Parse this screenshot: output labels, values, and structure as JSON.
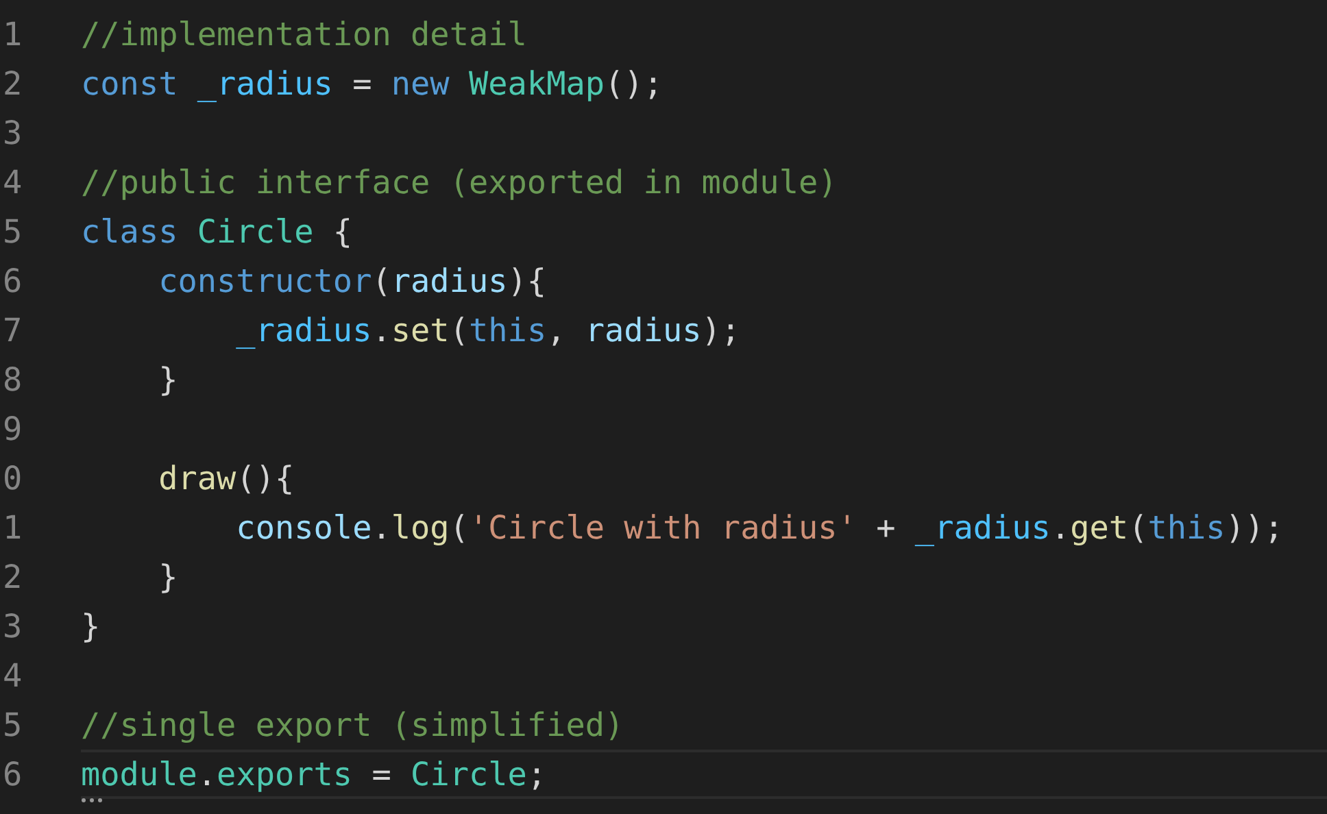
{
  "editor": {
    "lines": [
      {
        "number": "1",
        "current": false,
        "tokens": [
          {
            "kind": "comment",
            "text": "//implementation detail"
          }
        ]
      },
      {
        "number": "2",
        "current": false,
        "tokens": [
          {
            "kind": "keyword",
            "text": "const "
          },
          {
            "kind": "constant",
            "text": "_radius"
          },
          {
            "kind": "plain",
            "text": " = "
          },
          {
            "kind": "keyword",
            "text": "new "
          },
          {
            "kind": "type",
            "text": "WeakMap"
          },
          {
            "kind": "plain",
            "text": "();"
          }
        ]
      },
      {
        "number": "3",
        "current": false
      },
      {
        "number": "4",
        "current": false,
        "tokens": [
          {
            "kind": "comment",
            "text": "//public interface (exported in module)"
          }
        ]
      },
      {
        "number": "5",
        "current": false,
        "tokens": [
          {
            "kind": "keyword",
            "text": "class "
          },
          {
            "kind": "type",
            "text": "Circle"
          },
          {
            "kind": "plain",
            "text": " {"
          }
        ]
      },
      {
        "number": "6",
        "current": false,
        "tokens": [
          {
            "kind": "keyword",
            "text": "    constructor"
          },
          {
            "kind": "plain",
            "text": "("
          },
          {
            "kind": "variable",
            "text": "radius"
          },
          {
            "kind": "plain",
            "text": "){"
          }
        ]
      },
      {
        "number": "7",
        "current": false,
        "tokens": [
          {
            "kind": "constant",
            "text": "        _radius"
          },
          {
            "kind": "plain",
            "text": "."
          },
          {
            "kind": "function",
            "text": "set"
          },
          {
            "kind": "plain",
            "text": "("
          },
          {
            "kind": "keyword",
            "text": "this"
          },
          {
            "kind": "plain",
            "text": ", "
          },
          {
            "kind": "variable",
            "text": "radius"
          },
          {
            "kind": "plain",
            "text": ");"
          }
        ]
      },
      {
        "number": "8",
        "current": false,
        "tokens": [
          {
            "kind": "plain",
            "text": "    }"
          }
        ]
      },
      {
        "number": "9",
        "current": false
      },
      {
        "number": "0",
        "current": false,
        "tokens": [
          {
            "kind": "function",
            "text": "    draw"
          },
          {
            "kind": "plain",
            "text": "(){"
          }
        ]
      },
      {
        "number": "1",
        "current": false,
        "tokens": [
          {
            "kind": "variable",
            "text": "        console"
          },
          {
            "kind": "plain",
            "text": "."
          },
          {
            "kind": "function",
            "text": "log"
          },
          {
            "kind": "plain",
            "text": "("
          },
          {
            "kind": "string",
            "text": "'Circle with radius'"
          },
          {
            "kind": "plain",
            "text": " + "
          },
          {
            "kind": "constant",
            "text": "_radius"
          },
          {
            "kind": "plain",
            "text": "."
          },
          {
            "kind": "function",
            "text": "get"
          },
          {
            "kind": "plain",
            "text": "("
          },
          {
            "kind": "keyword",
            "text": "this"
          },
          {
            "kind": "plain",
            "text": "));"
          }
        ]
      },
      {
        "number": "2",
        "current": false,
        "tokens": [
          {
            "kind": "plain",
            "text": "    }"
          }
        ]
      },
      {
        "number": "3",
        "current": false,
        "tokens": [
          {
            "kind": "plain",
            "text": "}"
          }
        ]
      },
      {
        "number": "4",
        "current": false
      },
      {
        "number": "5",
        "current": false,
        "tokens": [
          {
            "kind": "comment",
            "text": "//single export (simplified)"
          }
        ]
      },
      {
        "number": "6",
        "current": true,
        "tokens": [
          {
            "kind": "type",
            "text": "module"
          },
          {
            "kind": "plain",
            "text": "."
          },
          {
            "kind": "type",
            "text": "exports"
          },
          {
            "kind": "plain",
            "text": " = "
          },
          {
            "kind": "type",
            "text": "Circle"
          },
          {
            "kind": "plain",
            "text": ";"
          }
        ]
      }
    ]
  }
}
